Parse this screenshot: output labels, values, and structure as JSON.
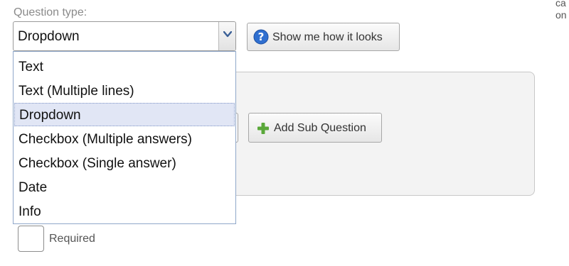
{
  "form": {
    "question_type_label": "Question type:",
    "question_type_value": "Dropdown",
    "corner_text": "ca on",
    "show_button_label": "Show me how it looks",
    "add_sub_question_label": "Add Sub Question",
    "required_label": "Required"
  },
  "dropdown": {
    "options": [
      "Text",
      "Text (Multiple lines)",
      "Dropdown",
      "Checkbox (Multiple answers)",
      "Checkbox (Single answer)",
      "Date",
      "Info"
    ],
    "selected_option": "Dropdown"
  },
  "icons": {
    "select_arrow": "chevron-down-icon",
    "help": "question-mark-icon",
    "add": "plus-icon"
  },
  "colors": {
    "help_icon": "#2f6fd0",
    "plus_icon": "#5aa83a",
    "selected_bg": "#e1e6f5"
  }
}
